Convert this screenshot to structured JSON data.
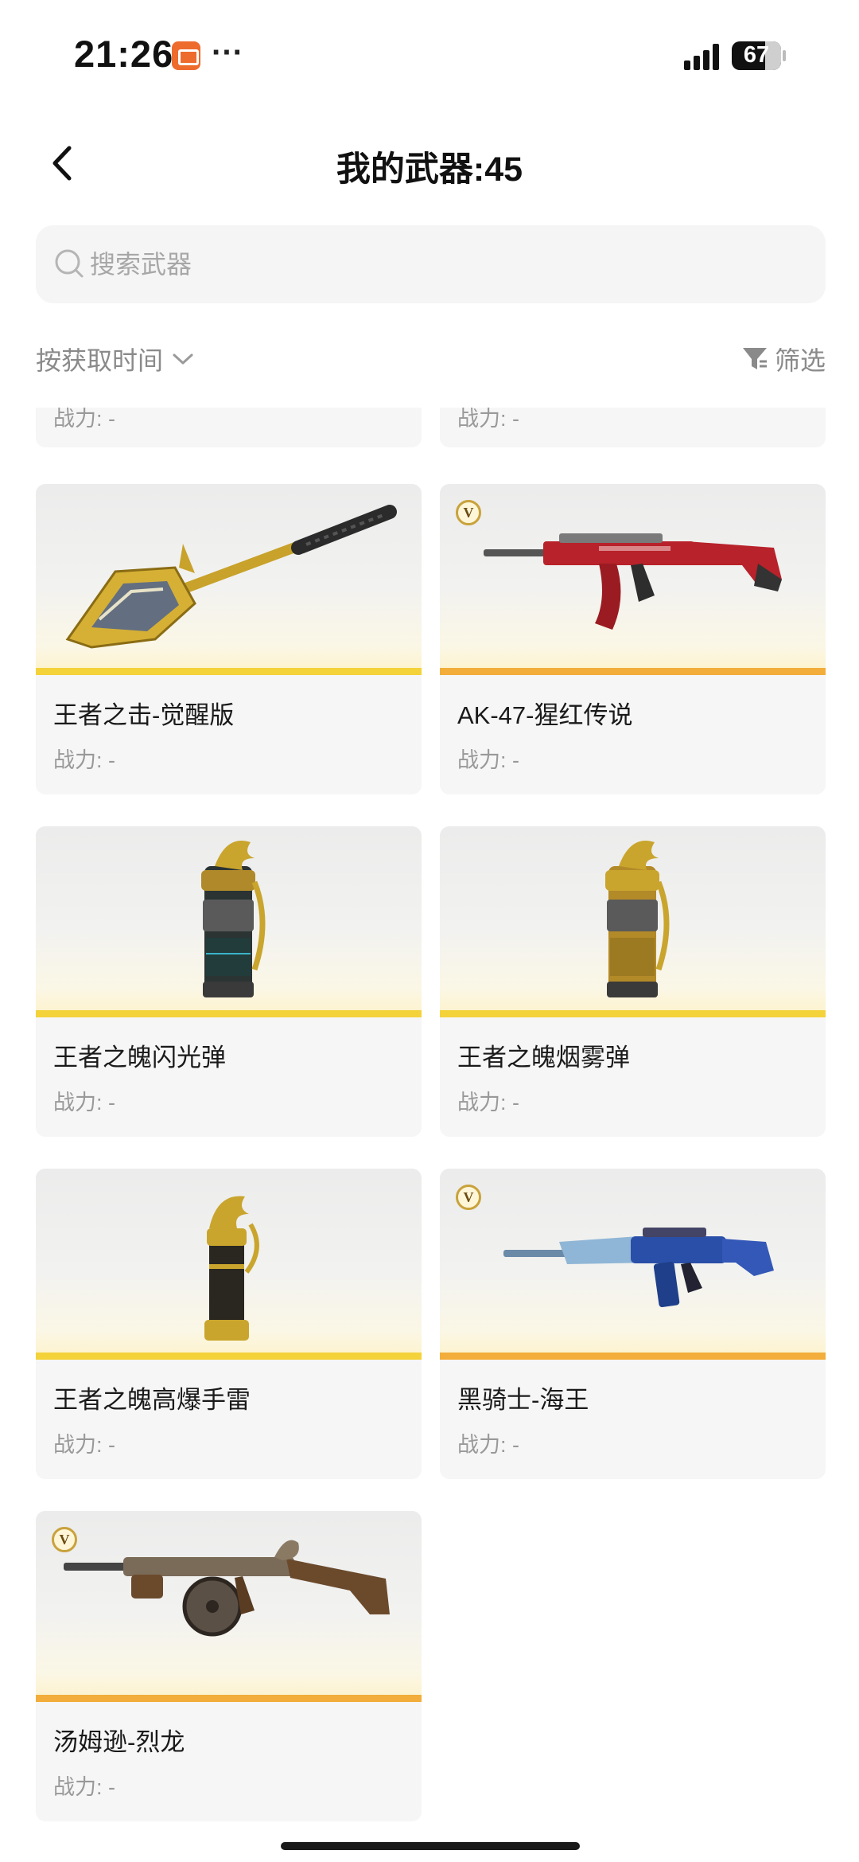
{
  "status_bar": {
    "time": "21:26",
    "battery": "67"
  },
  "header": {
    "title": "我的武器:45"
  },
  "search": {
    "placeholder": "搜索武器"
  },
  "sort_filter": {
    "sort_label": "按获取时间",
    "filter_label": "筛选"
  },
  "weapons": {
    "partial_power": "战力: -",
    "items": [
      {
        "name": "王者之击-觉醒版",
        "power": "战力: -",
        "badge": ""
      },
      {
        "name": "AK-47-猩红传说",
        "power": "战力: -",
        "badge": "V"
      },
      {
        "name": "王者之魄闪光弹",
        "power": "战力: -",
        "badge": ""
      },
      {
        "name": "王者之魄烟雾弹",
        "power": "战力: -",
        "badge": ""
      },
      {
        "name": "王者之魄高爆手雷",
        "power": "战力: -",
        "badge": ""
      },
      {
        "name": "黑骑士-海王",
        "power": "战力: -",
        "badge": "V"
      },
      {
        "name": "汤姆逊-烈龙",
        "power": "战力: -",
        "badge": "V"
      }
    ]
  },
  "colors": {
    "gold_bar": "#f4d23a",
    "orange_bar": "#f2ad3a",
    "badge_ring": "#c9a23c"
  }
}
